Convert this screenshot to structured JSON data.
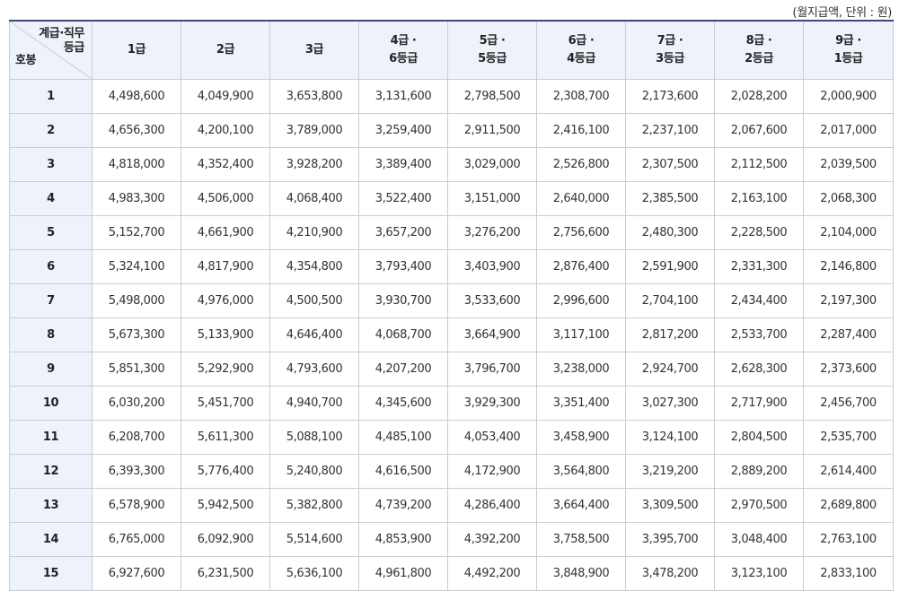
{
  "unit_note": "(월지급액, 단위 : 원)",
  "corner": {
    "top1": "계급·직무",
    "top2": "등급",
    "bottom": "호봉"
  },
  "columns": [
    {
      "l1": "1급",
      "l2": ""
    },
    {
      "l1": "2급",
      "l2": ""
    },
    {
      "l1": "3급",
      "l2": ""
    },
    {
      "l1": "4급 ·",
      "l2": "6등급"
    },
    {
      "l1": "5급 ·",
      "l2": "5등급"
    },
    {
      "l1": "6급 ·",
      "l2": "4등급"
    },
    {
      "l1": "7급 ·",
      "l2": "3등급"
    },
    {
      "l1": "8급 ·",
      "l2": "2등급"
    },
    {
      "l1": "9급 ·",
      "l2": "1등급"
    }
  ],
  "rows": [
    {
      "step": "1",
      "values": [
        "4,498,600",
        "4,049,900",
        "3,653,800",
        "3,131,600",
        "2,798,500",
        "2,308,700",
        "2,173,600",
        "2,028,200",
        "2,000,900"
      ]
    },
    {
      "step": "2",
      "values": [
        "4,656,300",
        "4,200,100",
        "3,789,000",
        "3,259,400",
        "2,911,500",
        "2,416,100",
        "2,237,100",
        "2,067,600",
        "2,017,000"
      ]
    },
    {
      "step": "3",
      "values": [
        "4,818,000",
        "4,352,400",
        "3,928,200",
        "3,389,400",
        "3,029,000",
        "2,526,800",
        "2,307,500",
        "2,112,500",
        "2,039,500"
      ]
    },
    {
      "step": "4",
      "values": [
        "4,983,300",
        "4,506,000",
        "4,068,400",
        "3,522,400",
        "3,151,000",
        "2,640,000",
        "2,385,500",
        "2,163,100",
        "2,068,300"
      ]
    },
    {
      "step": "5",
      "values": [
        "5,152,700",
        "4,661,900",
        "4,210,900",
        "3,657,200",
        "3,276,200",
        "2,756,600",
        "2,480,300",
        "2,228,500",
        "2,104,000"
      ]
    },
    {
      "step": "6",
      "values": [
        "5,324,100",
        "4,817,900",
        "4,354,800",
        "3,793,400",
        "3,403,900",
        "2,876,400",
        "2,591,900",
        "2,331,300",
        "2,146,800"
      ]
    },
    {
      "step": "7",
      "values": [
        "5,498,000",
        "4,976,000",
        "4,500,500",
        "3,930,700",
        "3,533,600",
        "2,996,600",
        "2,704,100",
        "2,434,400",
        "2,197,300"
      ]
    },
    {
      "step": "8",
      "values": [
        "5,673,300",
        "5,133,900",
        "4,646,400",
        "4,068,700",
        "3,664,900",
        "3,117,100",
        "2,817,200",
        "2,533,700",
        "2,287,400"
      ]
    },
    {
      "step": "9",
      "values": [
        "5,851,300",
        "5,292,900",
        "4,793,600",
        "4,207,200",
        "3,796,700",
        "3,238,000",
        "2,924,700",
        "2,628,300",
        "2,373,600"
      ]
    },
    {
      "step": "10",
      "values": [
        "6,030,200",
        "5,451,700",
        "4,940,700",
        "4,345,600",
        "3,929,300",
        "3,351,400",
        "3,027,300",
        "2,717,900",
        "2,456,700"
      ]
    },
    {
      "step": "11",
      "values": [
        "6,208,700",
        "5,611,300",
        "5,088,100",
        "4,485,100",
        "4,053,400",
        "3,458,900",
        "3,124,100",
        "2,804,500",
        "2,535,700"
      ]
    },
    {
      "step": "12",
      "values": [
        "6,393,300",
        "5,776,400",
        "5,240,800",
        "4,616,500",
        "4,172,900",
        "3,564,800",
        "3,219,200",
        "2,889,200",
        "2,614,400"
      ]
    },
    {
      "step": "13",
      "values": [
        "6,578,900",
        "5,942,500",
        "5,382,800",
        "4,739,200",
        "4,286,400",
        "3,664,400",
        "3,309,500",
        "2,970,500",
        "2,689,800"
      ]
    },
    {
      "step": "14",
      "values": [
        "6,765,000",
        "6,092,900",
        "5,514,600",
        "4,853,900",
        "4,392,200",
        "3,758,500",
        "3,395,700",
        "3,048,400",
        "2,763,100"
      ]
    },
    {
      "step": "15",
      "values": [
        "6,927,600",
        "6,231,500",
        "5,636,100",
        "4,961,800",
        "4,492,200",
        "3,848,900",
        "3,478,200",
        "3,123,100",
        "2,833,100"
      ]
    }
  ]
}
